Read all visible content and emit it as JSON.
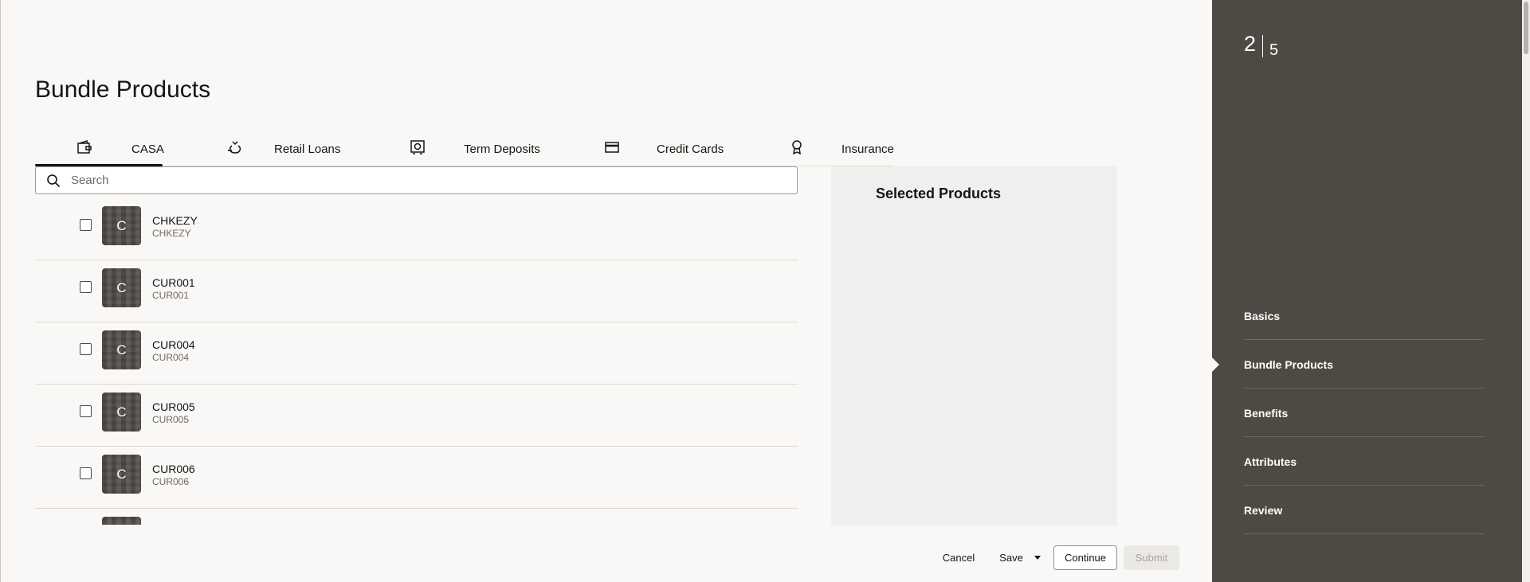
{
  "page": {
    "title": "Bundle Products"
  },
  "tabs": [
    {
      "label": "CASA",
      "icon": "wallet-icon",
      "active": true
    },
    {
      "label": "Retail Loans",
      "icon": "money-bag-icon",
      "active": false
    },
    {
      "label": "Term Deposits",
      "icon": "vault-icon",
      "active": false
    },
    {
      "label": "Credit Cards",
      "icon": "credit-card-icon",
      "active": false
    },
    {
      "label": "Insurance",
      "icon": "badge-icon",
      "active": false
    }
  ],
  "search": {
    "placeholder": "Search",
    "value": ""
  },
  "products": [
    {
      "initial": "C",
      "name": "CHKEZY",
      "code": "CHKEZY"
    },
    {
      "initial": "C",
      "name": "CUR001",
      "code": "CUR001"
    },
    {
      "initial": "C",
      "name": "CUR004",
      "code": "CUR004"
    },
    {
      "initial": "C",
      "name": "CUR005",
      "code": "CUR005"
    },
    {
      "initial": "C",
      "name": "CUR006",
      "code": "CUR006"
    },
    {
      "initial": "C",
      "name": "",
      "code": ""
    }
  ],
  "selected_panel": {
    "title": "Selected Products"
  },
  "footer": {
    "cancel_label": "Cancel",
    "save_label": "Save",
    "continue_label": "Continue",
    "submit_label": "Submit"
  },
  "train": {
    "current_step": "2",
    "total_steps": "5",
    "steps": [
      {
        "label": "Basics"
      },
      {
        "label": "Bundle Products",
        "current": true
      },
      {
        "label": "Benefits"
      },
      {
        "label": "Attributes"
      },
      {
        "label": "Review"
      }
    ]
  },
  "colors": {
    "sidebar_bg": "#4f4944",
    "panel_bg": "#f1efed",
    "page_bg": "#f9f8f6"
  }
}
